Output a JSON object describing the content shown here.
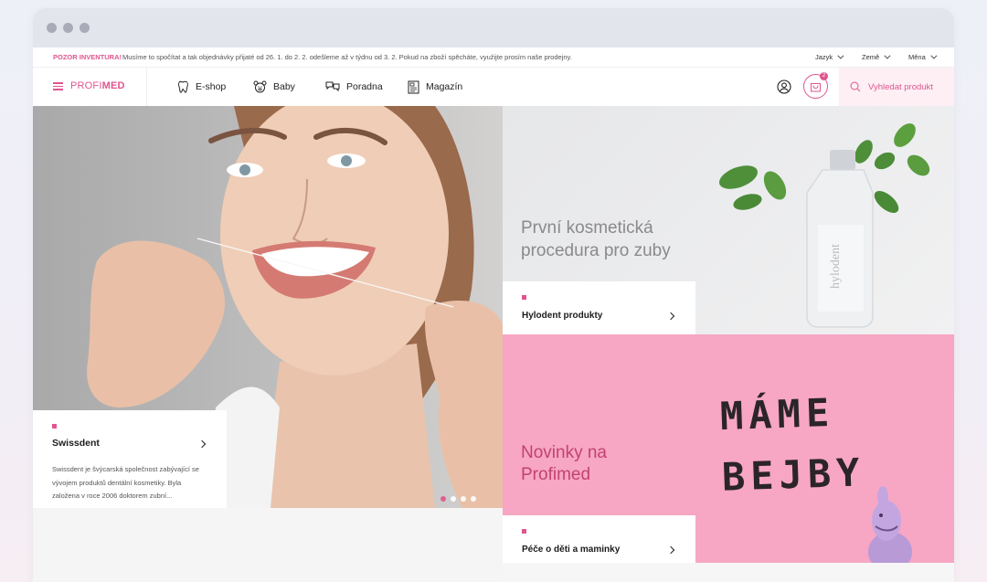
{
  "notice": {
    "label": "POZOR INVENTURA!",
    "message": "Musíme to spočítat a tak objednávky přijaté od 26. 1. do 2. 2. odešleme až v týdnu od 3. 2. Pokud na zboží spěcháte, využijte prosím naše prodejny.",
    "selectors": [
      {
        "label": "Jazyk"
      },
      {
        "label": "Země"
      },
      {
        "label": "Měna"
      }
    ]
  },
  "nav": {
    "logo_part1": "PROFI",
    "logo_part2": "MED",
    "items": [
      {
        "label": "E-shop",
        "icon": "tooth-icon"
      },
      {
        "label": "Baby",
        "icon": "bear-icon"
      },
      {
        "label": "Poradna",
        "icon": "chat-icon"
      },
      {
        "label": "Magazín",
        "icon": "magazine-icon"
      }
    ],
    "cart_count": "2",
    "search_placeholder": "Vyhledat produkt"
  },
  "hero": {
    "card_title": "Swissdent",
    "card_desc": "Swissdent je švýcarská společnost zabývající se vývojem produktů dentální kosmetiky. Byla založena v roce 2006 doktorem zubní...",
    "slides": 4,
    "active_slide": 1
  },
  "tile_top": {
    "headline_line1": "První kosmetická",
    "headline_line2": "procedura pro zuby",
    "card_title": "Hylodent produkty"
  },
  "tile_bottom": {
    "headline_line1": "Novinky na",
    "headline_line2": "Profimed",
    "hand_line1": "MÁME",
    "hand_line2": "BEJBY",
    "card_title": "Péče o děti a maminky"
  },
  "colors": {
    "accent": "#e0558e",
    "pink_tile": "#f7a6c4",
    "headline_gray": "#8a8a8d",
    "headline_pink": "#c2436f"
  }
}
